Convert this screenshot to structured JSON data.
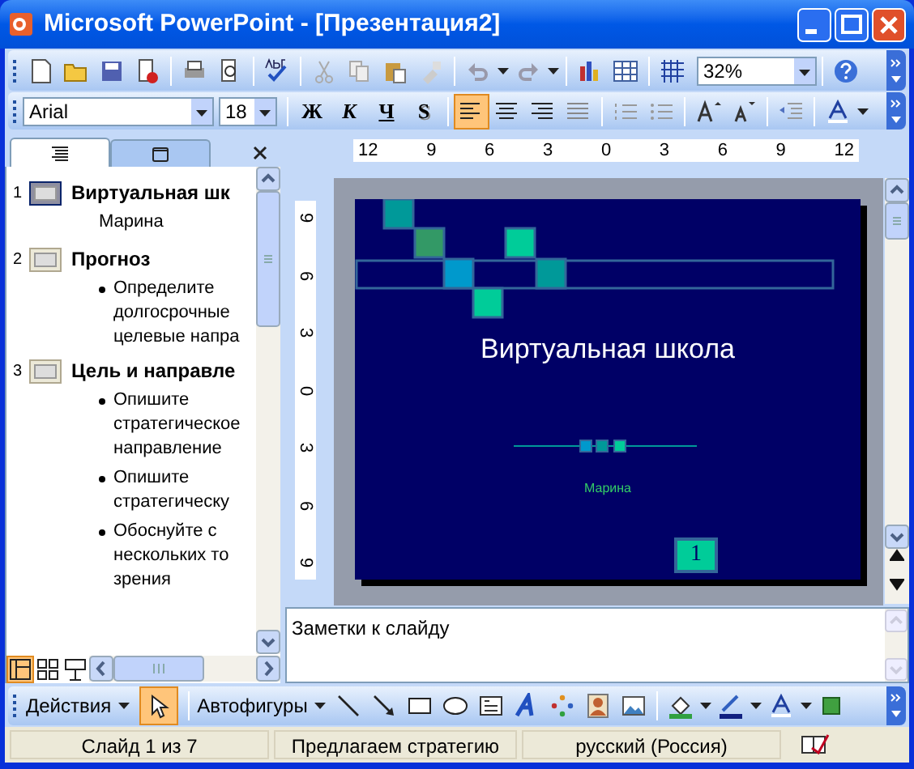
{
  "window": {
    "title": "Microsoft PowerPoint - [Презентация2]"
  },
  "standard_toolbar": {
    "zoom": "32%"
  },
  "formatting_toolbar": {
    "font": "Arial",
    "size": "18",
    "styles": [
      {
        "label": "Ж",
        "kind": "bold"
      },
      {
        "label": "К",
        "kind": "italic"
      },
      {
        "label": "Ч",
        "kind": "underline"
      },
      {
        "label": "S",
        "kind": "shadow"
      }
    ],
    "alignment": [
      {
        "kind": "left",
        "selected": true
      },
      {
        "kind": "center",
        "selected": false
      },
      {
        "kind": "right",
        "selected": false
      },
      {
        "kind": "justify",
        "selected": false
      }
    ]
  },
  "pane_tabs": [
    {
      "kind": "outline",
      "selected": true
    },
    {
      "kind": "slides",
      "selected": false
    }
  ],
  "outline": [
    {
      "number": "1",
      "title": "Виртуальная шк",
      "selected": true,
      "children": [
        {
          "kind": "subtitle",
          "text": "Марина"
        }
      ]
    },
    {
      "number": "2",
      "title": "Прогноз",
      "selected": false,
      "children": [
        {
          "kind": "bullet",
          "text": "Определите долгосрочные целевые напра"
        }
      ]
    },
    {
      "number": "3",
      "title": "Цель и направле",
      "selected": false,
      "children": [
        {
          "kind": "bullet",
          "text": "Опишите стратегическое направление"
        },
        {
          "kind": "bullet",
          "text": "Опишите стратегическу"
        },
        {
          "kind": "bullet",
          "text": "Обоснуйте с нескольких то зрения"
        }
      ]
    }
  ],
  "view_buttons": [
    {
      "kind": "normal",
      "selected": true
    },
    {
      "kind": "sorter",
      "selected": false
    },
    {
      "kind": "show",
      "selected": false
    }
  ],
  "ruler": {
    "horizontal": [
      "12",
      "9",
      "6",
      "3",
      "0",
      "3",
      "6",
      "9",
      "12"
    ],
    "vertical": [
      "9",
      "6",
      "3",
      "0",
      "3",
      "6",
      "9"
    ]
  },
  "slide": {
    "title": "Виртуальная школа",
    "subtitle": "Марина",
    "number": "1"
  },
  "notes": {
    "placeholder": "Заметки к слайду"
  },
  "drawing_toolbar": {
    "actions": "Действия",
    "autoshapes": "Автофигуры",
    "select_tool_selected": true
  },
  "status_bar": [
    "Слайд 1 из 7",
    "Предлагаем стратегию",
    "русский (Россия)"
  ]
}
